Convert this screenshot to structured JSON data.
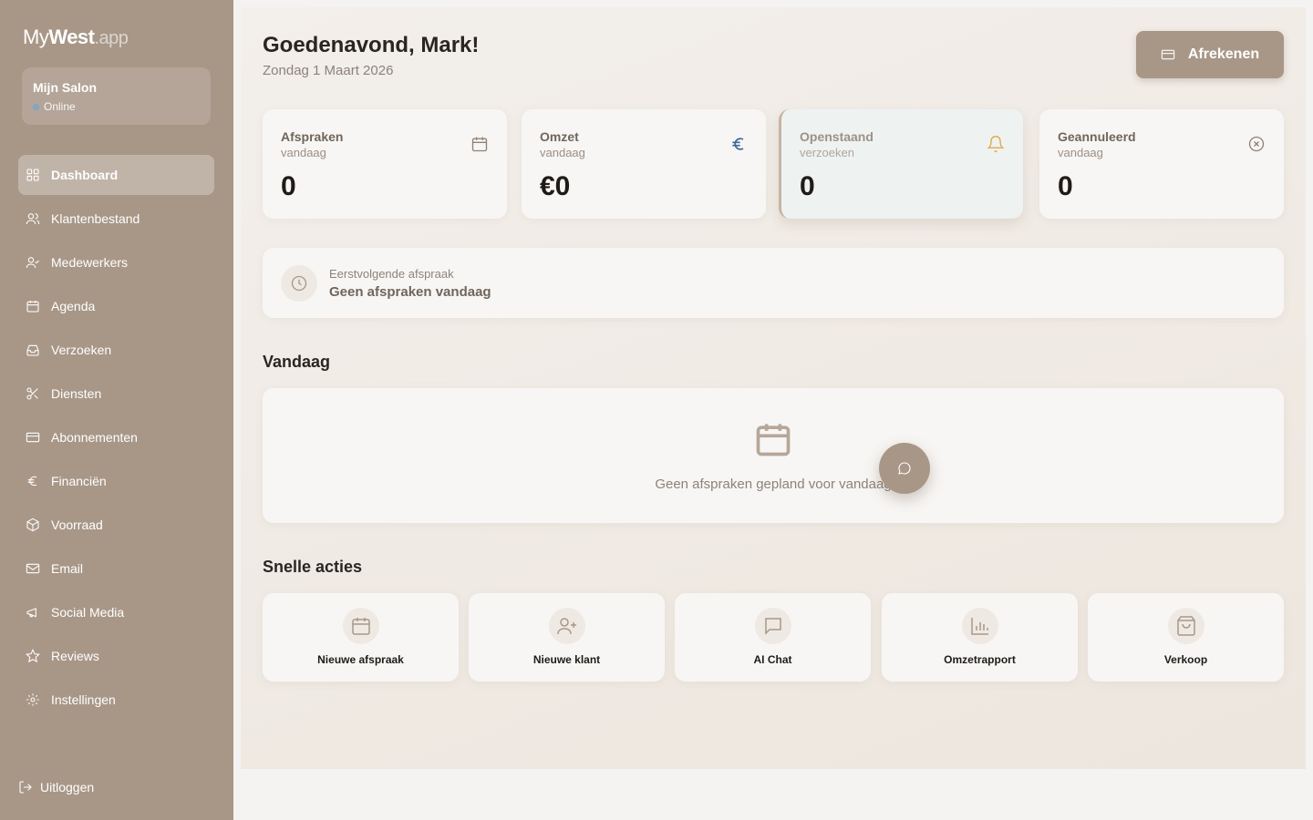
{
  "brand": {
    "part1": "My",
    "part2": "West",
    "part3": ".app"
  },
  "salon": {
    "name": "Mijn Salon",
    "status": "Online"
  },
  "sidebar": {
    "items": [
      {
        "label": "Dashboard",
        "icon": "grid-icon"
      },
      {
        "label": "Klantenbestand",
        "icon": "users-icon"
      },
      {
        "label": "Medewerkers",
        "icon": "user-check-icon"
      },
      {
        "label": "Agenda",
        "icon": "calendar-icon"
      },
      {
        "label": "Verzoeken",
        "icon": "inbox-icon"
      },
      {
        "label": "Diensten",
        "icon": "scissors-icon"
      },
      {
        "label": "Abonnementen",
        "icon": "card-icon"
      },
      {
        "label": "Financiën",
        "icon": "euro-icon"
      },
      {
        "label": "Voorraad",
        "icon": "box-icon"
      },
      {
        "label": "Email",
        "icon": "mail-icon"
      },
      {
        "label": "Social Media",
        "icon": "megaphone-icon"
      },
      {
        "label": "Reviews",
        "icon": "star-icon"
      },
      {
        "label": "Instellingen",
        "icon": "gear-icon"
      }
    ],
    "logout": "Uitloggen"
  },
  "header": {
    "greeting": "Goedenavond, Mark!",
    "date": "Zondag 1 Maart 2026",
    "checkout_label": "Afrekenen"
  },
  "stats": [
    {
      "title": "Afspraken",
      "sub": "vandaag",
      "value": "0",
      "icon": "calendar-icon",
      "color": "#8d8278"
    },
    {
      "title": "Omzet",
      "sub": "vandaag",
      "value": "€0",
      "icon": "euro-icon",
      "color": "#3b6a9a"
    },
    {
      "title": "Openstaand",
      "sub": "verzoeken",
      "value": "0",
      "icon": "bell-icon",
      "color": "#e0a84a"
    },
    {
      "title": "Geannuleerd",
      "sub": "vandaag",
      "value": "0",
      "icon": "x-circle-icon",
      "color": "#8d8278"
    }
  ],
  "next_appointment": {
    "label": "Eerstvolgende afspraak",
    "value": "Geen afspraken vandaag"
  },
  "today": {
    "title": "Vandaag",
    "empty": "Geen afspraken gepland voor vandaag"
  },
  "quick_actions": {
    "title": "Snelle acties",
    "items": [
      {
        "label": "Nieuwe afspraak",
        "icon": "calendar-icon"
      },
      {
        "label": "Nieuwe klant",
        "icon": "user-plus-icon"
      },
      {
        "label": "AI Chat",
        "icon": "chat-icon"
      },
      {
        "label": "Omzetrapport",
        "icon": "bar-chart-icon"
      },
      {
        "label": "Verkoop",
        "icon": "shopping-bag-icon"
      }
    ]
  },
  "colors": {
    "sidebar": "#a89787",
    "accent": "#a89787",
    "euro": "#3b6a9a",
    "bell": "#e0a84a"
  }
}
